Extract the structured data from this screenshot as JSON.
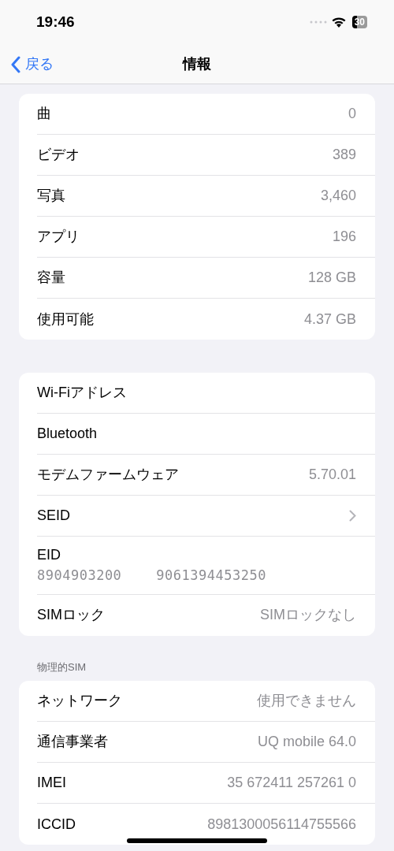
{
  "status_bar": {
    "time": "19:46",
    "battery": "30"
  },
  "nav": {
    "back": "戻る",
    "title": "情報"
  },
  "sections": [
    {
      "rows": [
        {
          "kind": "value",
          "label": "曲",
          "value": "0"
        },
        {
          "kind": "value",
          "label": "ビデオ",
          "value": "389"
        },
        {
          "kind": "value",
          "label": "写真",
          "value": "3,460"
        },
        {
          "kind": "value",
          "label": "アプリ",
          "value": "196"
        },
        {
          "kind": "value",
          "label": "容量",
          "value": "128 GB"
        },
        {
          "kind": "value",
          "label": "使用可能",
          "value": "4.37 GB"
        }
      ]
    },
    {
      "rows": [
        {
          "kind": "plain",
          "label": "Wi-Fiアドレス"
        },
        {
          "kind": "plain",
          "label": "Bluetooth"
        },
        {
          "kind": "value",
          "label": "モデムファームウェア",
          "value": "5.70.01"
        },
        {
          "kind": "chevron",
          "label": "SEID"
        },
        {
          "kind": "stacked",
          "label": "EID",
          "parts": [
            "8904903200",
            "9061394453250"
          ]
        },
        {
          "kind": "value",
          "label": "SIMロック",
          "value": "SIMロックなし"
        }
      ]
    },
    {
      "header": "物理的SIM",
      "rows": [
        {
          "kind": "value",
          "label": "ネットワーク",
          "value": "使用できません"
        },
        {
          "kind": "value",
          "label": "通信事業者",
          "value": "UQ mobile 64.0"
        },
        {
          "kind": "value",
          "label": "IMEI",
          "value": "35 672411 257261 0"
        },
        {
          "kind": "value",
          "label": "ICCID",
          "value": "8981300056114755566"
        }
      ]
    }
  ]
}
